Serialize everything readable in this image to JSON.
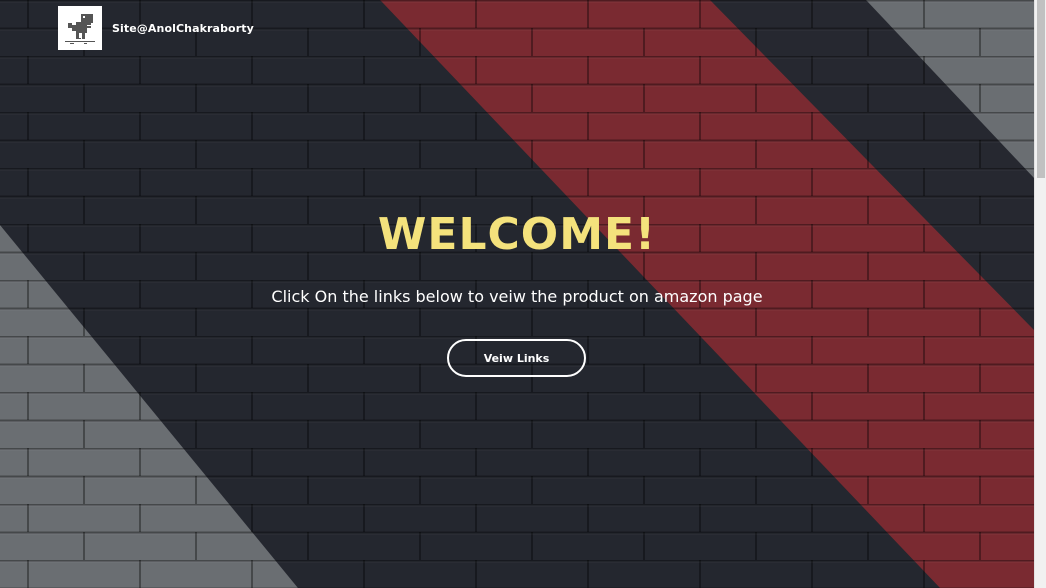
{
  "header": {
    "brand": "Site@AnolChakraborty",
    "logo_icon": "dino-icon"
  },
  "hero": {
    "title": "WELCOME!",
    "subtitle": "Click On the links below to veiw the product on amazon page",
    "button_label": "Veiw Links"
  },
  "colors": {
    "title": "#f4e27c",
    "text": "#ffffff",
    "wall_dark": "#262830",
    "stripe_red": "#7a2a31",
    "stripe_gray": "#6a6e72"
  }
}
